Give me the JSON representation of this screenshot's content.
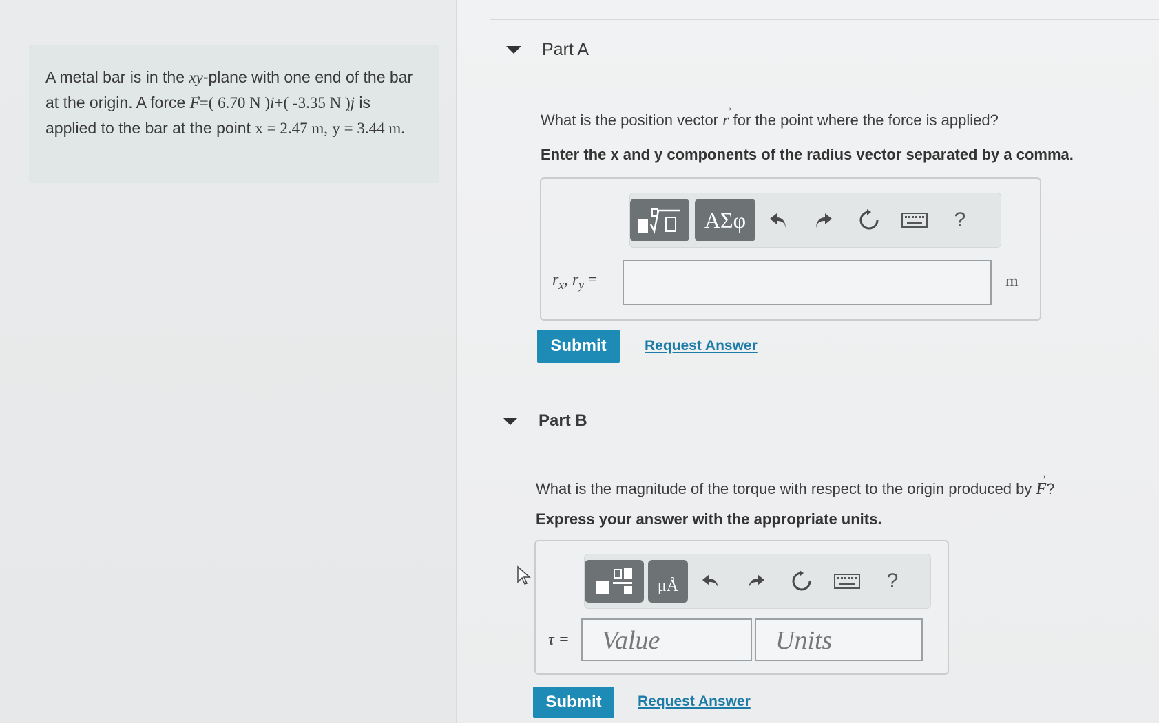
{
  "problem": {
    "text_1": "A metal bar is in the",
    "text_xy": "xy",
    "text_2": "-plane with one end of the bar at the origin. A force",
    "force_symbol": "F",
    "force_expr": "=( 6.70 N )",
    "i_hat": "i",
    "plus": "+( -3.35 N )",
    "j_hat": "j",
    "text_3": "is applied to the bar at the point",
    "x_point": "x = 2.47 m,",
    "y_point": "y = 3.44 m."
  },
  "part_a": {
    "header": "Part A",
    "question_pre": "What is the position vector",
    "vector": "r",
    "question_post": "for the point where the force is applied?",
    "instruction": "Enter the x and y components of the radius vector separated by a comma.",
    "toolbar": {
      "template_label": "√",
      "greek_label": "ΑΣφ",
      "help": "?"
    },
    "input_label": "rx, ry =",
    "input_label_r1": "r",
    "input_label_sub1": "x",
    "input_label_r2": "r",
    "input_label_sub2": "y",
    "input_label_eq": "=",
    "unit": "m",
    "submit": "Submit",
    "request": "Request Answer"
  },
  "part_b": {
    "header": "Part B",
    "question_pre": "What is the magnitude of the torque with respect to the origin produced by",
    "vector": "F",
    "question_post": "?",
    "instruction": "Express your answer with the appropriate units.",
    "toolbar": {
      "units_label": "μÅ",
      "help": "?"
    },
    "input_label": "τ =",
    "value_placeholder": "Value",
    "units_placeholder": "Units",
    "submit": "Submit",
    "request": "Request Answer"
  },
  "colors": {
    "accent": "#1d8bb6",
    "link": "#1c7ca7",
    "toolbar_dark": "#6d7275"
  }
}
